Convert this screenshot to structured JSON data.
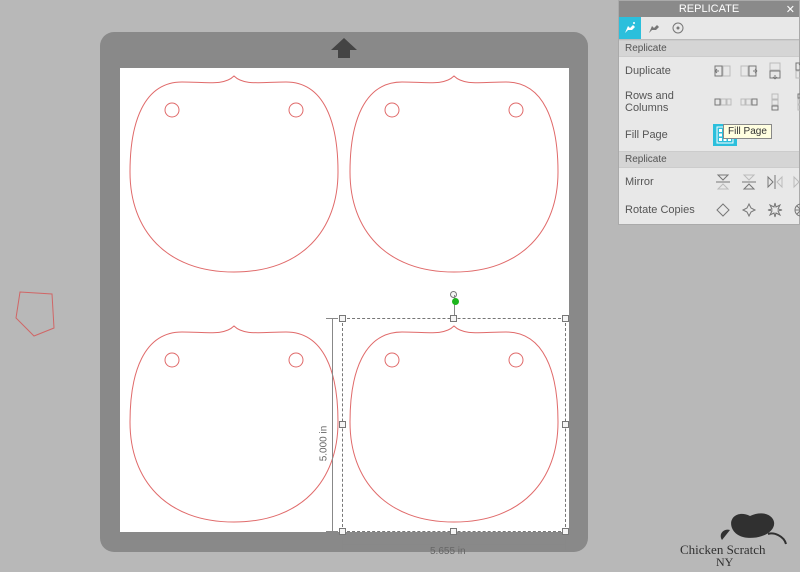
{
  "panel": {
    "title": "REPLICATE",
    "sections": [
      {
        "header": "Replicate"
      },
      {
        "header": "Replicate"
      }
    ],
    "rows": {
      "duplicate": {
        "label": "Duplicate"
      },
      "rowscols": {
        "label": "Rows and Columns"
      },
      "fillpage": {
        "label": "Fill Page"
      },
      "mirror": {
        "label": "Mirror"
      },
      "rotate": {
        "label": "Rotate Copies"
      }
    },
    "tooltip": "Fill Page"
  },
  "selection": {
    "width_label": "5.655 in",
    "height_label": "5.000 in"
  },
  "watermark": {
    "line1": "Chicken Scratch",
    "line2": "NY"
  }
}
